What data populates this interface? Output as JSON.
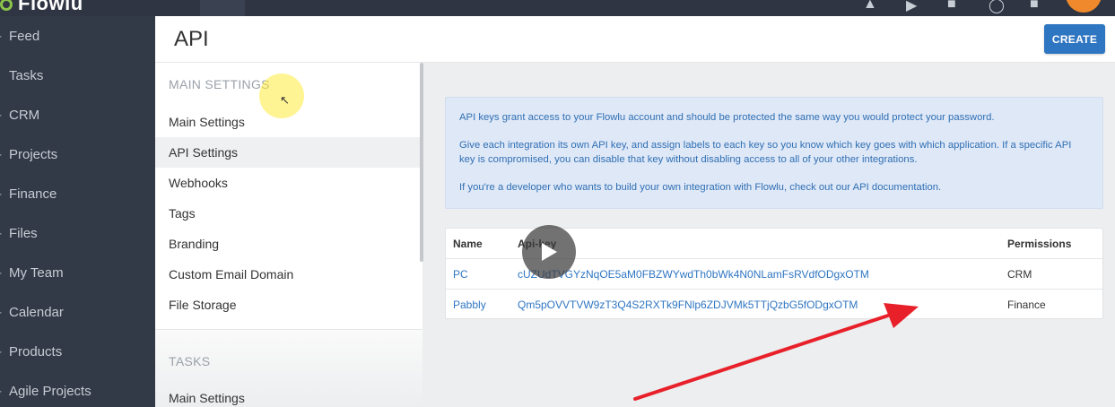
{
  "app": {
    "logo_text": "Flowlu"
  },
  "topbar": {
    "icons": [
      "bell-icon",
      "chat-icon",
      "mail-icon",
      "help-icon",
      "grid-icon"
    ],
    "avatar_color": "#f0892b"
  },
  "nav": {
    "items": [
      {
        "label": "Feed",
        "icon": "feed-icon"
      },
      {
        "label": "Tasks",
        "icon": "tasks-icon"
      },
      {
        "label": "CRM",
        "icon": "crm-icon"
      },
      {
        "label": "Projects",
        "icon": "projects-icon"
      },
      {
        "label": "Finance",
        "icon": "finance-icon"
      },
      {
        "label": "Files",
        "icon": "files-icon"
      },
      {
        "label": "My Team",
        "icon": "team-icon"
      },
      {
        "label": "Calendar",
        "icon": "calendar-icon"
      },
      {
        "label": "Products",
        "icon": "products-icon"
      },
      {
        "label": "Agile Projects",
        "icon": "agile-icon"
      }
    ]
  },
  "header": {
    "title": "API",
    "create_label": "CREATE"
  },
  "settings": {
    "main_section": "MAIN SETTINGS",
    "items": [
      "Main Settings",
      "API Settings",
      "Webhooks",
      "Tags",
      "Branding",
      "Custom Email Domain",
      "File Storage"
    ],
    "active_index": 1,
    "tasks_section": "TASKS",
    "tasks_items": [
      "Main Settings"
    ]
  },
  "info": {
    "p1": "API keys grant access to your Flowlu account and should be protected the same way you would protect your password.",
    "p2": "Give each integration its own API key, and assign labels to each key so you know which key goes with which application. If a specific API key is compromised, you can disable that key without disabling access to all of your other integrations.",
    "p3": "If you're a developer who wants to build your own integration with Flowlu, check out our API documentation."
  },
  "table": {
    "headers": {
      "name": "Name",
      "key": "Api-key",
      "permissions": "Permissions"
    },
    "rows": [
      {
        "name": "PC",
        "key": "cUZUdTVGYzNqOE5aM0FBZWYwdTh0bWk4N0NLamFsRVdfODgxOTM",
        "permissions": "CRM"
      },
      {
        "name": "Pabbly",
        "key": "Qm5pOVVTVW9zT3Q4S2RXTk9FNlp6ZDJVMk5TTjQzbG5fODgxOTM",
        "permissions": "Finance"
      }
    ]
  },
  "colors": {
    "accent": "#2f76c2",
    "sidebar": "#323a47",
    "topbar": "#2f3542",
    "annotation_arrow": "#e8202a"
  }
}
